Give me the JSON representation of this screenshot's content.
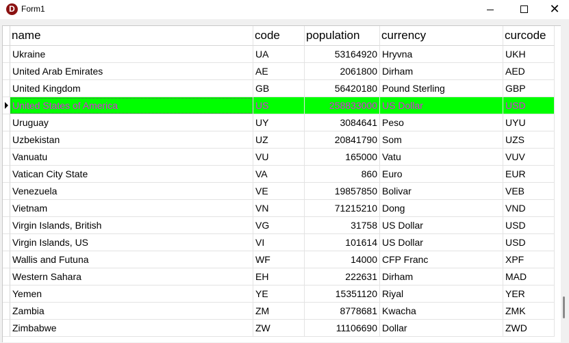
{
  "window": {
    "title": "Form1",
    "icon_letter": "D",
    "close_glyph": "✕"
  },
  "grid": {
    "columns": [
      "name",
      "code",
      "population",
      "currency",
      "curcode"
    ],
    "selected_index": 3,
    "selected_colors": {
      "background": "#00ff00",
      "text": "#e020e0"
    },
    "rows": [
      [
        "Ukraine",
        "UA",
        "53164920",
        "Hryvna",
        "UKH"
      ],
      [
        "United Arab Emirates",
        "AE",
        "2061800",
        "Dirham",
        "AED"
      ],
      [
        "United Kingdom",
        "GB",
        "56420180",
        "Pound Sterling",
        "GBP"
      ],
      [
        "United States of America",
        "US",
        "258833000",
        "US Dollar",
        "USD"
      ],
      [
        "Uruguay",
        "UY",
        "3084641",
        "Peso",
        "UYU"
      ],
      [
        "Uzbekistan",
        "UZ",
        "20841790",
        "Som",
        "UZS"
      ],
      [
        "Vanuatu",
        "VU",
        "165000",
        "Vatu",
        "VUV"
      ],
      [
        "Vatican City State",
        "VA",
        "860",
        "Euro",
        "EUR"
      ],
      [
        "Venezuela",
        "VE",
        "19857850",
        "Bolivar",
        "VEB"
      ],
      [
        "Vietnam",
        "VN",
        "71215210",
        "Dong",
        "VND"
      ],
      [
        "Virgin Islands, British",
        "VG",
        "31758",
        "US Dollar",
        "USD"
      ],
      [
        "Virgin Islands, US",
        "VI",
        "101614",
        "US Dollar",
        "USD"
      ],
      [
        "Wallis and Futuna",
        "WF",
        "14000",
        "CFP Franc",
        "XPF"
      ],
      [
        "Western Sahara",
        "EH",
        "222631",
        "Dirham",
        "MAD"
      ],
      [
        "Yemen",
        "YE",
        "15351120",
        "Riyal",
        "YER"
      ],
      [
        "Zambia",
        "ZM",
        "8778681",
        "Kwacha",
        "ZMK"
      ],
      [
        "Zimbabwe",
        "ZW",
        "11106690",
        "Dollar",
        "ZWD"
      ]
    ]
  }
}
